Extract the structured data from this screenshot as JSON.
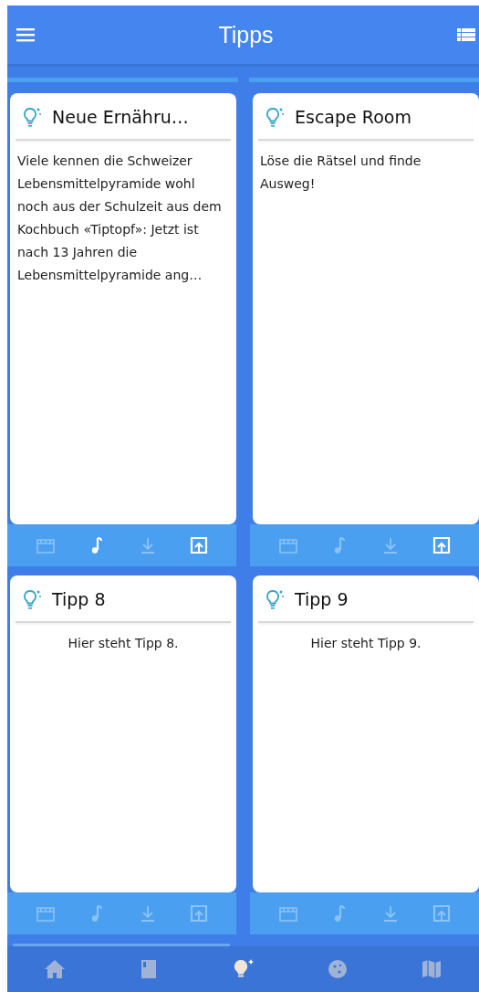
{
  "app_bar": {
    "title": "Tipps"
  },
  "cards": [
    {
      "title": "Neue Ernähru…",
      "body": "Viele kennen die Schweizer Lebensmittelpyramide wohl noch aus der Schulzeit aus dem Kochbuch «Tiptopf»: Jetzt ist nach 13 Jahren die Lebensmittelpyramide ang…",
      "kind": "text",
      "actions": [
        {
          "kind": "clapper",
          "on": false
        },
        {
          "kind": "note",
          "on": true
        },
        {
          "kind": "download",
          "on": false
        },
        {
          "kind": "share",
          "on": true
        }
      ]
    },
    {
      "title": "Escape Room",
      "body": "Löse die Rätsel und finde Ausweg!",
      "kind": "text",
      "actions": [
        {
          "kind": "clapper",
          "on": false
        },
        {
          "kind": "note",
          "on": false
        },
        {
          "kind": "download",
          "on": false
        },
        {
          "kind": "share",
          "on": true
        }
      ]
    },
    {
      "title": "Tipp 8",
      "body": "Hier steht Tipp 8.",
      "kind": "placeholder",
      "actions": [
        {
          "kind": "clapper",
          "on": false
        },
        {
          "kind": "note",
          "on": false
        },
        {
          "kind": "download",
          "on": false
        },
        {
          "kind": "share",
          "on": false
        }
      ]
    },
    {
      "title": "Tipp 9",
      "body": "Hier steht Tipp 9.",
      "kind": "placeholder",
      "actions": [
        {
          "kind": "clapper",
          "on": false
        },
        {
          "kind": "note",
          "on": false
        },
        {
          "kind": "download",
          "on": false
        },
        {
          "kind": "share",
          "on": false
        }
      ]
    }
  ],
  "bottom_nav": [
    {
      "kind": "home",
      "selected": false
    },
    {
      "kind": "book",
      "selected": false
    },
    {
      "kind": "bulb",
      "selected": true
    },
    {
      "kind": "cookie",
      "selected": false
    },
    {
      "kind": "map",
      "selected": false
    }
  ]
}
